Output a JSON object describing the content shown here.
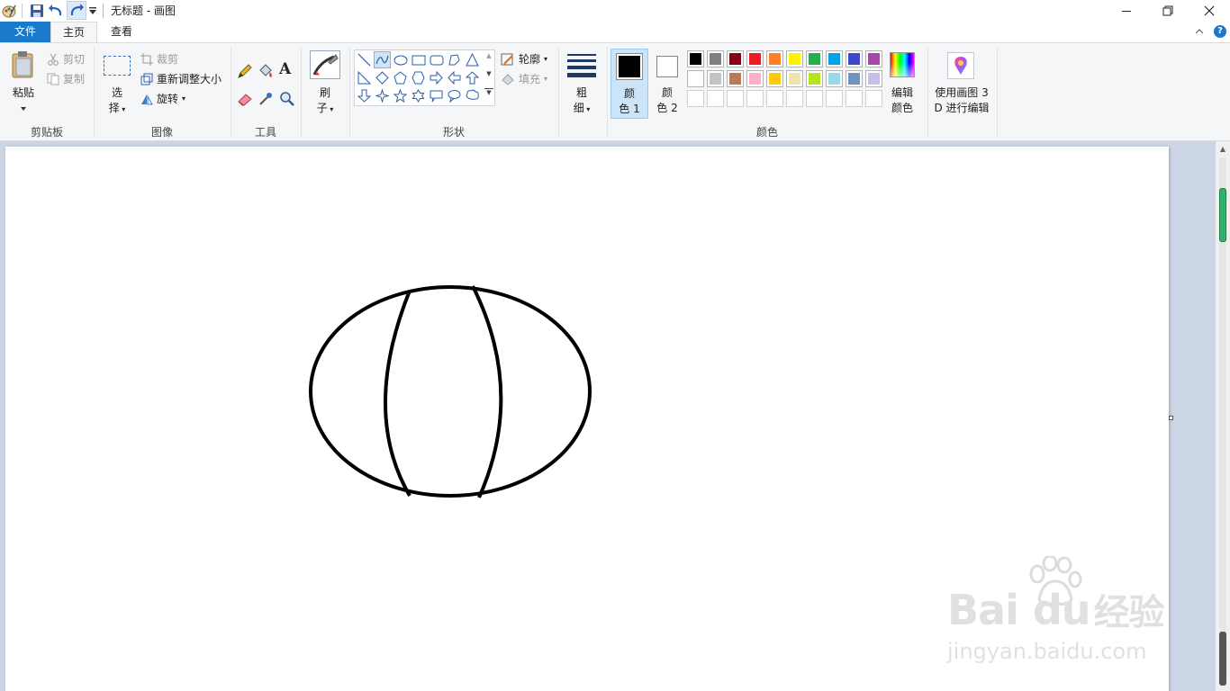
{
  "window": {
    "title": "无标题 - 画图"
  },
  "tabs": {
    "file": "文件",
    "home": "主页",
    "view": "查看"
  },
  "clipboard": {
    "paste": "粘贴",
    "cut": "剪切",
    "copy": "复制",
    "group_label": "剪贴板"
  },
  "image": {
    "select_top": "选",
    "select_bottom": "择",
    "crop": "裁剪",
    "resize": "重新调整大小",
    "rotate": "旋转",
    "group_label": "图像"
  },
  "tools": {
    "group_label": "工具",
    "text_glyph": "A"
  },
  "brushes": {
    "label_top": "刷",
    "label_bottom": "子"
  },
  "shapes": {
    "outline": "轮廓",
    "fill": "填充",
    "group_label": "形状"
  },
  "size": {
    "label_top": "粗",
    "label_bottom": "细"
  },
  "colors": {
    "color1_top": "颜",
    "color1_bottom": "色 1",
    "color2_top": "颜",
    "color2_bottom": "色 2",
    "edit_top": "编辑",
    "edit_bottom": "颜色",
    "group_label": "颜色",
    "color1_value": "#000000",
    "color2_value": "#ffffff",
    "palette_row1": [
      "#000000",
      "#7f7f7f",
      "#880015",
      "#ed1c24",
      "#ff7f27",
      "#fff200",
      "#22b14c",
      "#00a2e8",
      "#3f48cc",
      "#a349a4"
    ],
    "palette_row2": [
      "#ffffff",
      "#c3c3c3",
      "#b97a57",
      "#ffaec9",
      "#ffc90e",
      "#efe4b0",
      "#b5e61d",
      "#99d9ea",
      "#7092be",
      "#c8bfe7"
    ]
  },
  "paint3d": {
    "label_top": "使用画图 3",
    "label_bottom": "D 进行编辑"
  },
  "watermark": {
    "brand": "Bai",
    "brand2": "du",
    "cn": "经验",
    "url": "jingyan.baidu.com"
  }
}
